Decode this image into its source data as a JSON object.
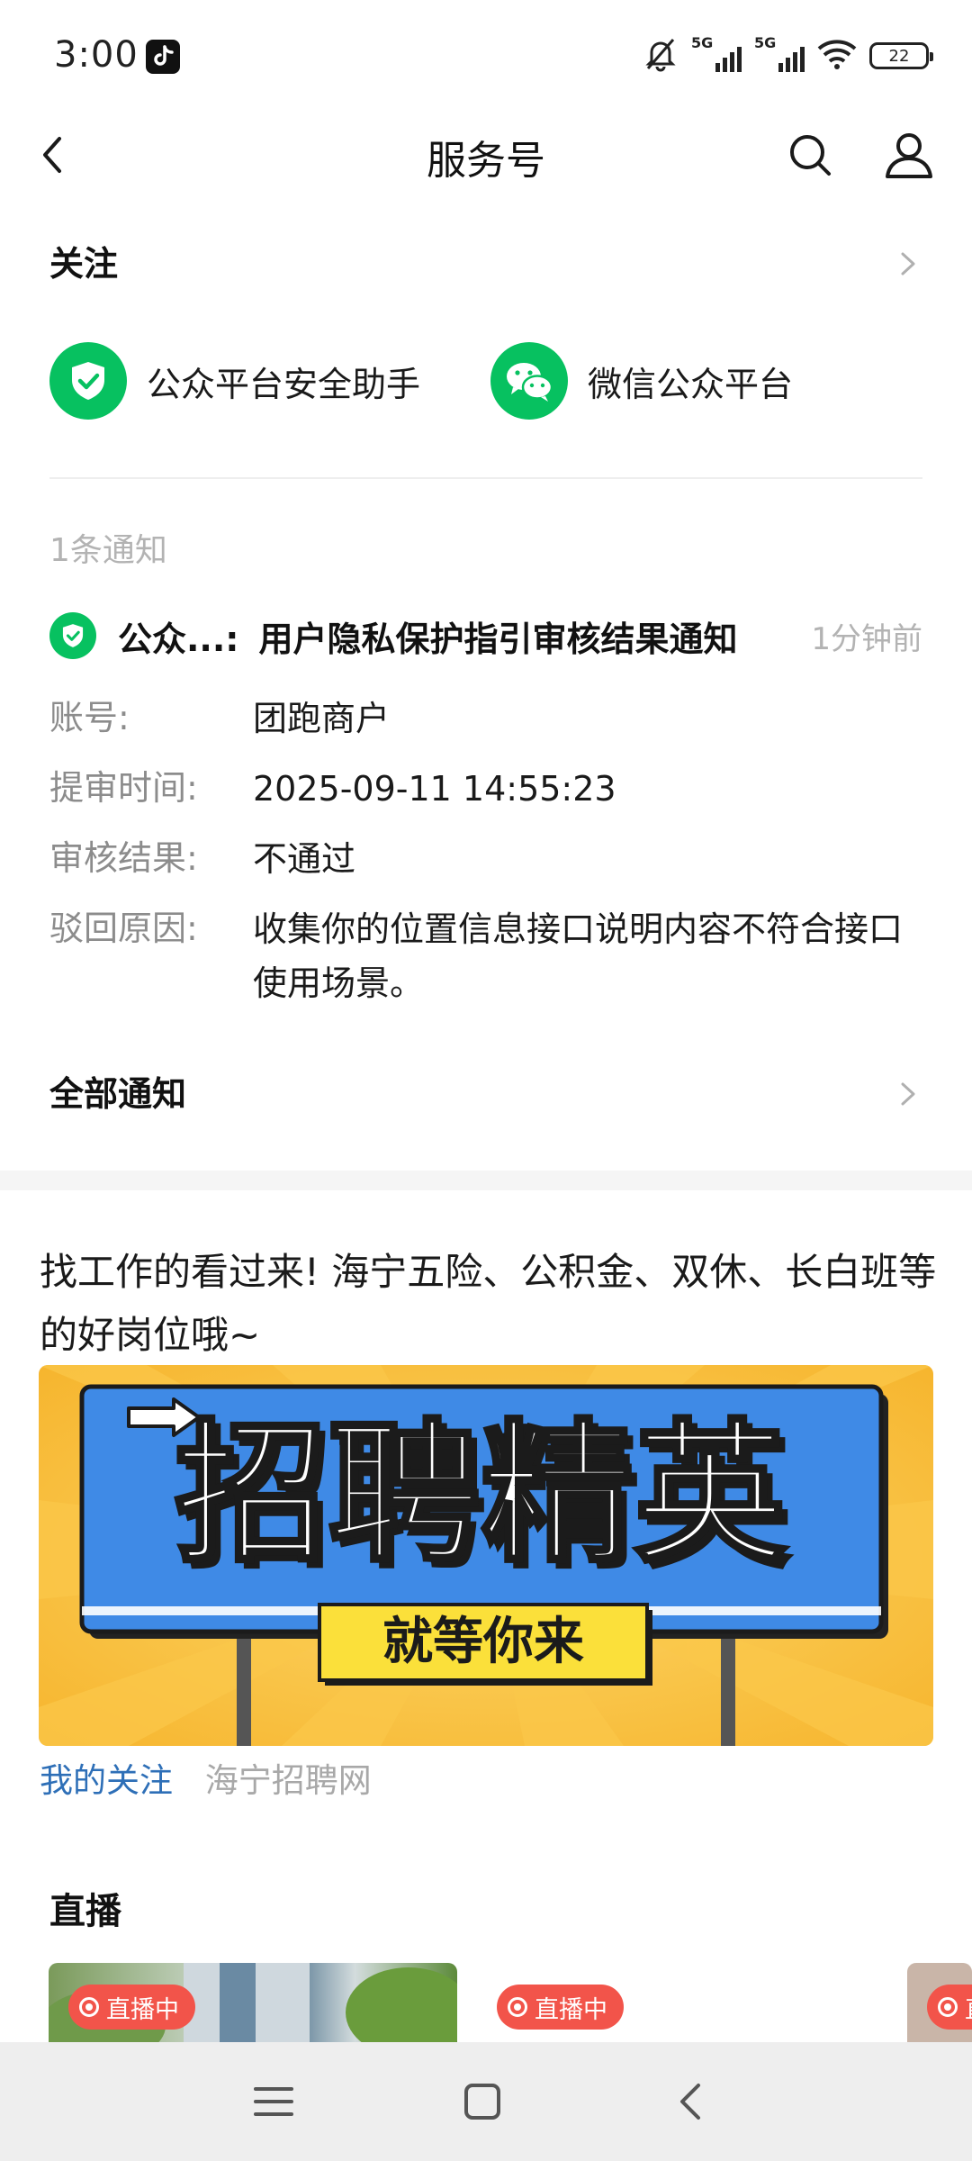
{
  "status_bar": {
    "time": "3:00",
    "network1": "5G",
    "network2": "5G",
    "battery": "22",
    "icons": [
      "tiktok-icon",
      "mute-bell-icon",
      "signal-icon",
      "signal-icon",
      "wifi-icon",
      "battery-icon"
    ]
  },
  "nav": {
    "title": "服务号",
    "icons": [
      "back-icon",
      "search-icon",
      "user-icon"
    ]
  },
  "follow": {
    "title": "关注",
    "accounts": [
      {
        "name": "公众平台安全助手",
        "icon": "shield-check-icon",
        "color": "#07c160"
      },
      {
        "name": "微信公众平台",
        "icon": "wechat-icon",
        "color": "#07c160"
      }
    ]
  },
  "notification": {
    "count_label": "1条通知",
    "source": "公众...:",
    "title": "用户隐私保护指引审核结果通知",
    "time": "1分钟前",
    "fields": [
      {
        "label": "账号:",
        "value": "团跑商户"
      },
      {
        "label": "提审时间:",
        "value": "2025-09-11 14:55:23"
      },
      {
        "label": "审核结果:",
        "value": "不通过"
      },
      {
        "label": "驳回原因:",
        "value": "收集你的位置信息接口说明内容不符合接口使用场景。"
      }
    ],
    "all_label": "全部通知"
  },
  "article": {
    "title": "找工作的看过来! 海宁五险、公积金、双休、长白班等的好岗位哦~",
    "banner_main": "招聘精英",
    "banner_sub": "就等你来",
    "follow_label": "我的关注",
    "source": "海宁招聘网"
  },
  "live": {
    "title": "直播",
    "badge": "直播中",
    "badge_partial": "直"
  },
  "colors": {
    "accent_green": "#07c160",
    "link_blue": "#2e6fb7",
    "live_red": "#f2544a",
    "banner_yellow": "#f8c13a",
    "banner_blue": "#3f8ae6"
  }
}
